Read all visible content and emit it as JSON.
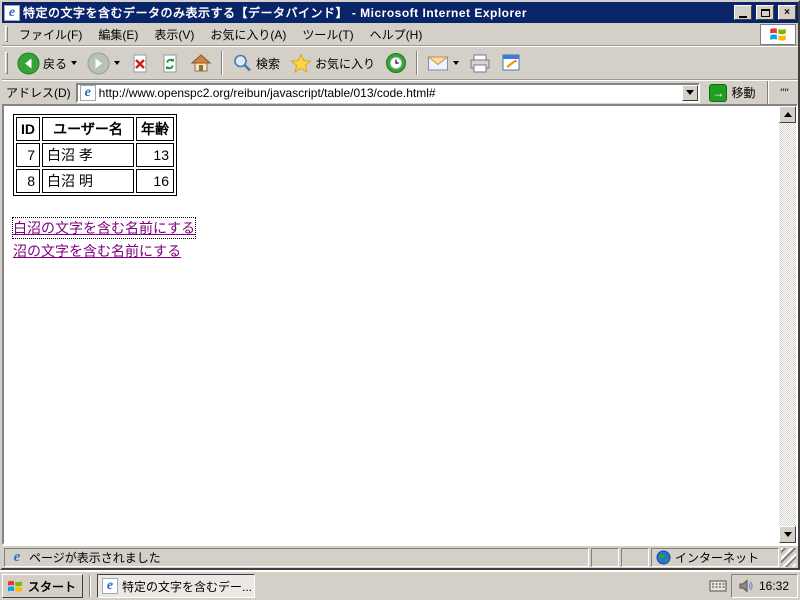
{
  "window": {
    "title": "特定の文字を含むデータのみ表示する【データバインド】 - Microsoft Internet Explorer"
  },
  "menubar": {
    "items": [
      {
        "label": "ファイル(F)"
      },
      {
        "label": "編集(E)"
      },
      {
        "label": "表示(V)"
      },
      {
        "label": "お気に入り(A)"
      },
      {
        "label": "ツール(T)"
      },
      {
        "label": "ヘルプ(H)"
      }
    ]
  },
  "toolbar": {
    "back_label": "戻る",
    "search_label": "検索",
    "favorites_label": "お気に入り"
  },
  "addressbar": {
    "label": "アドレス(D)",
    "url": "http://www.openspc2.org/reibun/javascript/table/013/code.html#",
    "go_label": "移動",
    "links_label": "\"\""
  },
  "content": {
    "table": {
      "headers": [
        "ID",
        "ユーザー名",
        "年齢"
      ],
      "rows": [
        [
          "7",
          "白沼 孝",
          "13"
        ],
        [
          "8",
          "白沼 明",
          "16"
        ]
      ]
    },
    "links": [
      "白沼の文字を含む名前にする",
      "沼の文字を含む名前にする"
    ]
  },
  "statusbar": {
    "text": "ページが表示されました",
    "zone": "インターネット"
  },
  "taskbar": {
    "start_label": "スタート",
    "task_label": "特定の文字を含むデー...",
    "time": "16:32"
  },
  "colors": {
    "titlebar": "#0a246a",
    "chrome": "#d4d0c8",
    "visited_link": "#800080",
    "go_green": "#1f9e1f"
  }
}
